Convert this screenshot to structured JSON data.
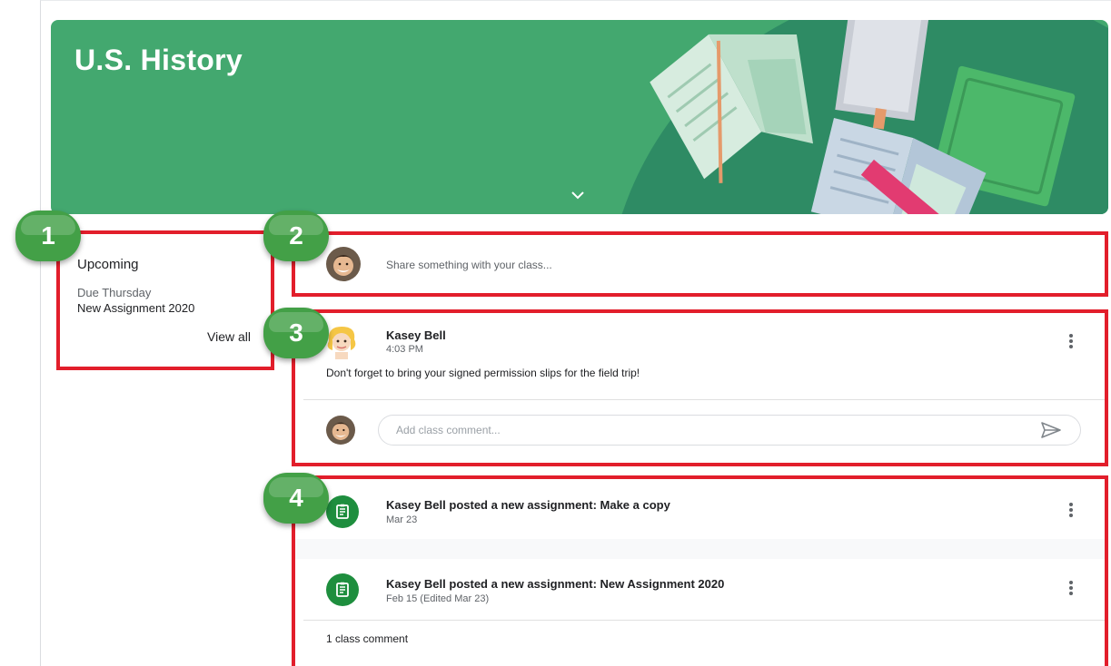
{
  "banner": {
    "title": "U.S. History",
    "color": "#43a86f",
    "expand_icon": "chevron-down-icon"
  },
  "callouts": [
    "1",
    "2",
    "3",
    "4"
  ],
  "highlight_color": "#e21e2b",
  "badge_color": "#43a047",
  "upcoming": {
    "title": "Upcoming",
    "due_label": "Due Thursday",
    "item": "New Assignment 2020",
    "view_all": "View all"
  },
  "share": {
    "placeholder": "Share something with your class..."
  },
  "post": {
    "author": "Kasey Bell",
    "time": "4:03 PM",
    "body": "Don't forget to bring your signed permission slips for the field trip!",
    "comment_placeholder": "Add class comment...",
    "menu_icon": "more-vert-icon",
    "send_icon": "send-icon"
  },
  "assignments": [
    {
      "title": "Kasey Bell posted a new assignment: Make a copy",
      "date": "Mar 23",
      "icon": "assignment-icon"
    },
    {
      "title": "Kasey Bell posted a new assignment: New Assignment 2020",
      "date": "Feb 15 (Edited Mar 23)",
      "icon": "assignment-icon"
    }
  ],
  "class_comment": "1 class comment"
}
